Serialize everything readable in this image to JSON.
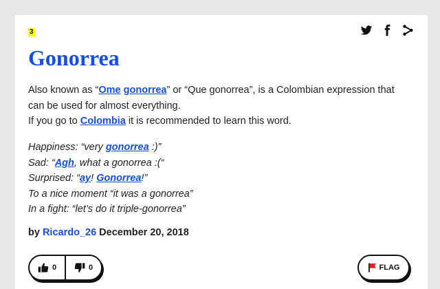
{
  "entry": {
    "rank": "3",
    "word": "Gonorrea",
    "meaning": {
      "l1_a": "Also known as “",
      "l1_link1": "Ome",
      "l1_link2": "gonorrea",
      "l1_b": "” or “Que gonorrea”, is a Colombian expression that can be used for almost everything.",
      "l2_a": "If you go to ",
      "l2_link": "Colombia",
      "l2_b": " it is recommended to learn this word."
    },
    "example": {
      "e1_a": "Happiness: “very ",
      "e1_link": "gonorrea",
      "e1_b": " :)”",
      "e2_a": "Sad: “",
      "e2_link": "Agh",
      "e2_b": ", what a gonorrea :(“",
      "e3_a": "Surprised: “",
      "e3_link1": "ay",
      "e3_mid": "! ",
      "e3_link2": "Gonorrea",
      "e3_b": "!”",
      "e4": "To a nice moment “it was a gonorrea”",
      "e5": "In a fight: “let’s do it triple-gonorrea”"
    },
    "contributor": {
      "by": "by ",
      "author": "Ricardo_26",
      "date": " December 20, 2018"
    },
    "votes": {
      "up": "0",
      "down": "0"
    },
    "flag_label": "FLAG"
  },
  "share_icons": [
    "twitter-icon",
    "facebook-icon",
    "share-icon"
  ],
  "colors": {
    "accent": "#134fe6",
    "highlight": "#ffff00",
    "flag": "#e81e1e"
  }
}
